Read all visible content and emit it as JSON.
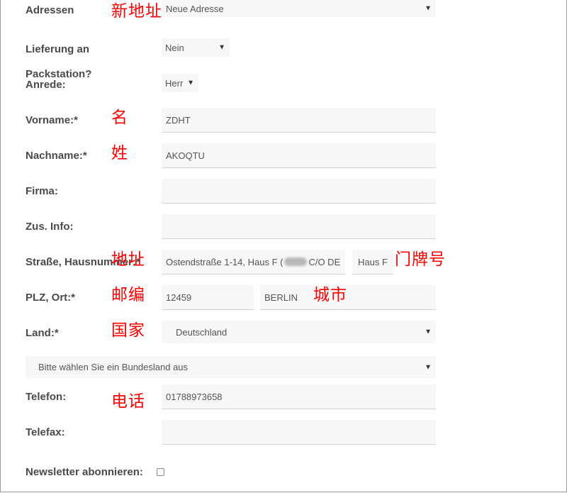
{
  "labels": {
    "adressen": "Adressen",
    "lieferung": "Lieferung an",
    "packstation": "Packstation?",
    "anrede": "Anrede:",
    "vorname": "Vorname:*",
    "nachname": "Nachname:*",
    "firma": "Firma:",
    "zus_info": "Zus. Info:",
    "strasse": "Straße, Hausnummer:*",
    "plz_ort": "PLZ, Ort:*",
    "land": "Land:*",
    "telefon": "Telefon:",
    "telefax": "Telefax:",
    "newsletter": "Newsletter abonnieren:"
  },
  "fields": {
    "adresse_select": "Neue Adresse",
    "lieferung_select": "Nein",
    "anrede_select": "Herr",
    "vorname": "ZDHT",
    "nachname": "AKOQTU",
    "firma": "",
    "zus_info": "",
    "strasse_part1": "Ostendstraße 1-14, Haus F (",
    "strasse_part2": "C/O DE",
    "hausnummer": "Haus F",
    "plz": "12459",
    "ort": "BERLIN",
    "land_select": "Deutschland",
    "bundesland_select": "Bitte wählen Sie ein Bundesland aus",
    "telefon": "01788973658",
    "telefax": ""
  },
  "newsletter_checked": false,
  "annotations": {
    "new_address": "新地址",
    "first_name": "名",
    "last_name": "姓",
    "address": "地址",
    "house_number": "门牌号",
    "postcode": "邮编",
    "city": "城市",
    "country": "国家",
    "phone": "电话"
  },
  "colors": {
    "annotation": "#ff0000",
    "field_bg": "#f7f7f7",
    "label": "#4a4a4a"
  }
}
